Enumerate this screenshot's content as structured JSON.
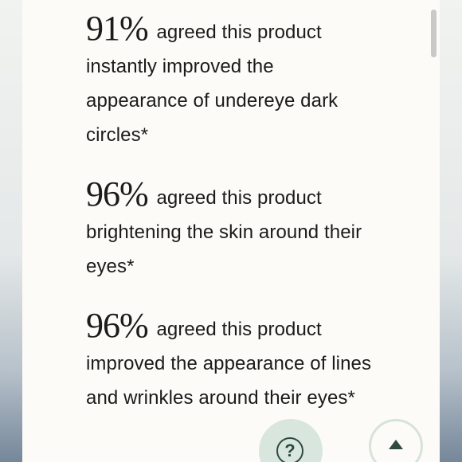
{
  "stats": [
    {
      "percent": "91%",
      "text": "agreed this product instantly improved the appearance of undereye dark circles*"
    },
    {
      "percent": "96%",
      "text": "agreed this product brightening the skin around their eyes*"
    },
    {
      "percent": "96%",
      "text": "agreed this product improved the appearance of lines and wrinkles around their eyes*"
    }
  ],
  "buttons": {
    "help_icon": "question-circle-icon",
    "help_glyph": "?",
    "top_icon": "arrow-up-icon"
  },
  "colors": {
    "panel": "#fdfbf7",
    "text": "#1b1b1b",
    "accent": "#2f4a3f",
    "accent_soft": "#d9e6dd"
  }
}
